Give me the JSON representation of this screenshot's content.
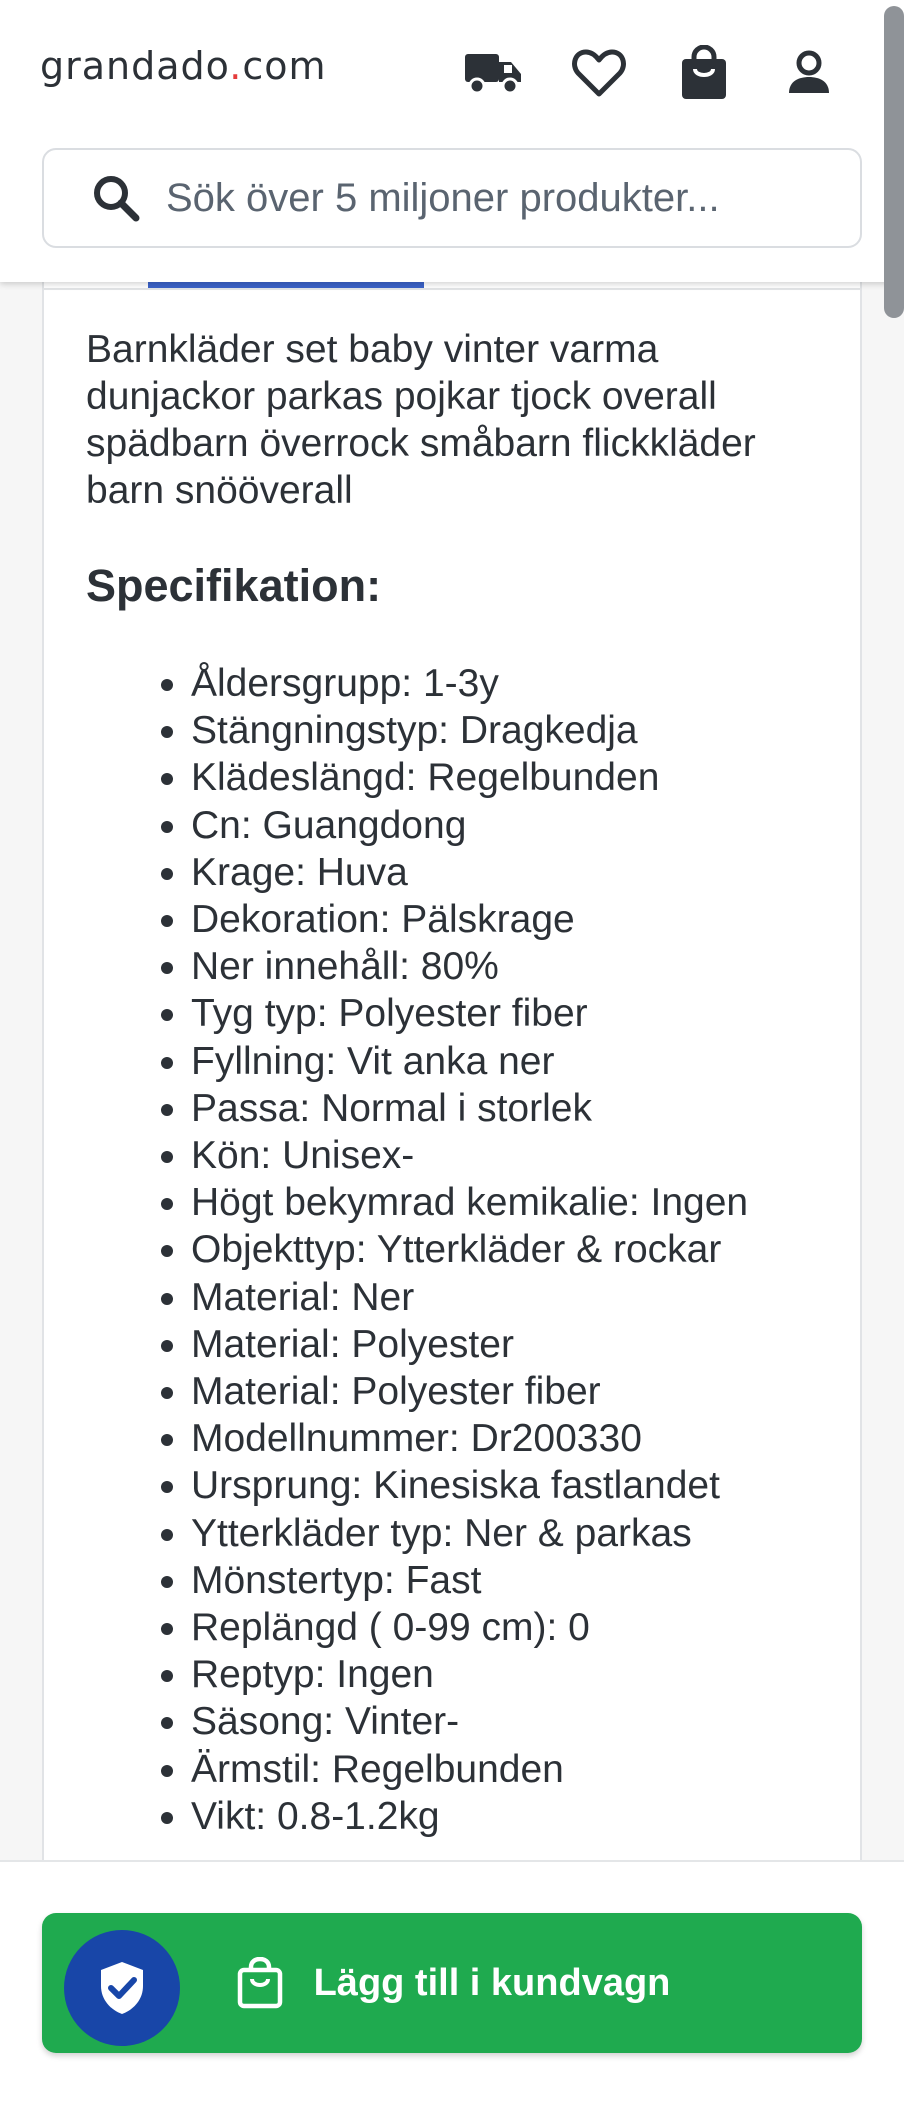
{
  "header": {
    "logo_main": "grandado",
    "logo_dot": ".",
    "logo_tld": "com",
    "icons": [
      "truck-icon",
      "heart-icon",
      "shopping-bag-icon",
      "user-icon"
    ]
  },
  "search": {
    "placeholder": "Sök över 5 miljoner produkter..."
  },
  "product": {
    "description": "Barnkläder set baby vinter varma dunjackor parkas pojkar tjock overall spädbarn överrock småbarn flickkläder barn snööverall",
    "spec_title": "Specifikation:",
    "specs": [
      "Åldersgrupp: 1-3y",
      "Stängningstyp: Dragkedja",
      "Klädeslängd: Regelbunden",
      "Cn: Guangdong",
      "Krage: Huva",
      "Dekoration: Pälskrage",
      "Ner innehåll: 80%",
      "Tyg typ: Polyester fiber",
      "Fyllning: Vit anka ner",
      "Passa: Normal i storlek",
      "Kön: Unisex-",
      "Högt bekymrad kemikalie: Ingen",
      "Objekttyp: Ytterkläder & rockar",
      "Material: Ner",
      "Material: Polyester",
      "Material: Polyester fiber",
      "Modellnummer: Dr200330",
      "Ursprung: Kinesiska fastlandet",
      "Ytterkläder typ: Ner & parkas",
      "Mönstertyp: Fast",
      "Replängd ( 0-99 cm): 0",
      "Reptyp: Ingen",
      "Säsong: Vinter-",
      "Ärmstil: Regelbunden",
      "Vikt: 0.8-1.2kg"
    ]
  },
  "cart": {
    "button_label": "Lägg till i kundvagn"
  },
  "colors": {
    "accent_green": "#1faa4f",
    "shield_blue": "#1846a8",
    "tab_blue": "#3b63c8",
    "logo_dot_red": "#e53b3b"
  }
}
